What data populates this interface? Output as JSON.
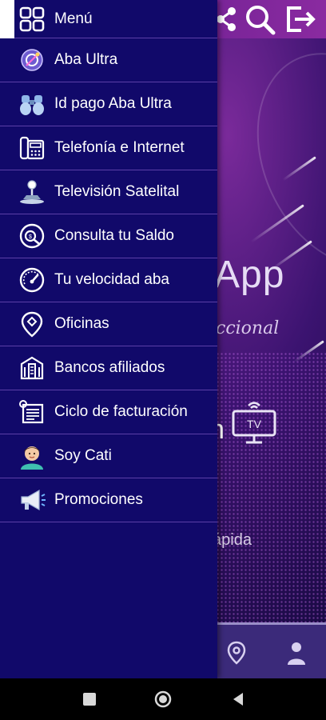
{
  "background": {
    "top_icons": [
      "share-icon",
      "search-icon",
      "exit-icon"
    ],
    "title_fragment": "App",
    "subtitle_fragment": "ccional",
    "letter_fragment": "n",
    "tv_label": "TV",
    "rapida_fragment": "ápida",
    "bottom_nav_icons": [
      "location-pin-icon",
      "user-icon"
    ]
  },
  "drawer": {
    "header": {
      "label": "Menú",
      "icon": "grid-menu-icon"
    },
    "items": [
      {
        "label": "Aba Ultra",
        "icon": "aba-ultra-icon"
      },
      {
        "label": "Id pago Aba Ultra",
        "icon": "binoculars-icon"
      },
      {
        "label": "Telefonía e Internet",
        "icon": "phone-fax-icon"
      },
      {
        "label": "Televisión Satelital",
        "icon": "satellite-dish-icon"
      },
      {
        "label": "Consulta tu Saldo",
        "icon": "balance-check-icon"
      },
      {
        "label": "Tu velocidad aba",
        "icon": "speedometer-icon"
      },
      {
        "label": "Oficinas",
        "icon": "location-pin-icon"
      },
      {
        "label": "Bancos afiliados",
        "icon": "bank-building-icon"
      },
      {
        "label": "Ciclo de facturación",
        "icon": "billing-receipt-icon"
      },
      {
        "label": "Soy Cati",
        "icon": "assistant-avatar-icon"
      },
      {
        "label": "Promociones",
        "icon": "megaphone-icon"
      }
    ]
  },
  "system_nav": {
    "buttons": [
      "recent-apps-icon",
      "home-icon",
      "back-icon"
    ]
  },
  "colors": {
    "drawer_bg": "#11096a",
    "divider": "#5a3fa6",
    "text": "#ffffff",
    "app_bg": "#3b1370"
  }
}
